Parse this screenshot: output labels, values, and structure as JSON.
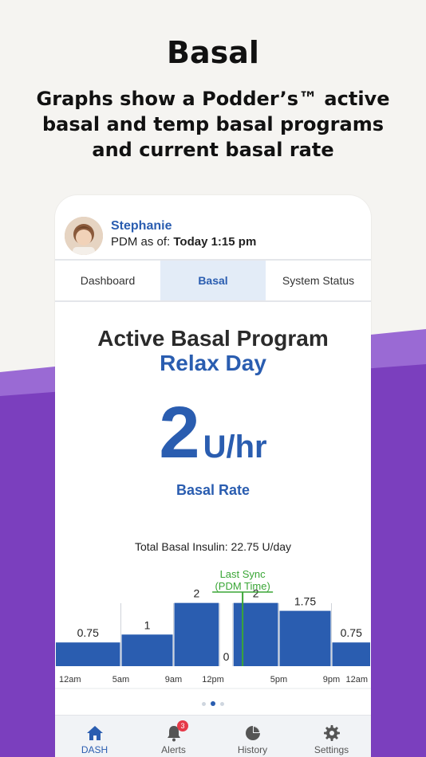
{
  "headline": "Basal",
  "subhead": "Graphs show a Podder’s™ active basal and temp basal programs and current basal rate",
  "profile": {
    "name": "Stephanie",
    "status_prefix": "PDM as of: ",
    "status_time": "Today 1:15 pm"
  },
  "tabs": [
    {
      "label": "Dashboard"
    },
    {
      "label": "Basal"
    },
    {
      "label": "System Status"
    }
  ],
  "program": {
    "heading": "Active Basal Program",
    "name": "Relax Day",
    "rate_value": "2",
    "rate_unit": "U/hr",
    "rate_label": "Basal Rate",
    "total_label": "Total Basal Insulin: 22.75 U/day"
  },
  "chart_data": {
    "type": "bar",
    "x_ticks": [
      "12am",
      "5am",
      "9am",
      "12pm",
      "5pm",
      "9pm",
      "12am"
    ],
    "segments": [
      {
        "start": 0,
        "end": 5,
        "value": 0.75,
        "label": "0.75"
      },
      {
        "start": 5,
        "end": 9,
        "value": 1,
        "label": "1"
      },
      {
        "start": 9,
        "end": 12.5,
        "value": 2,
        "label": "2"
      },
      {
        "start": 12.5,
        "end": 13.5,
        "value": 0,
        "label": "0"
      },
      {
        "start": 13.5,
        "end": 17,
        "value": 2,
        "label": "2"
      },
      {
        "start": 17,
        "end": 21,
        "value": 1.75,
        "label": "1.75"
      },
      {
        "start": 21,
        "end": 24,
        "value": 0.75,
        "label": "0.75"
      }
    ],
    "xlim": [
      0,
      24
    ],
    "ylim": [
      0,
      3.1
    ],
    "sync_marker": {
      "x": 14.25,
      "label_line1": "Last Sync",
      "label_line2": "(PDM Time)"
    },
    "colors": {
      "bar": "#2a5db0",
      "sync": "#3aa636",
      "divider": "#cfd3d9"
    }
  },
  "pager": {
    "count": 3,
    "active": 1
  },
  "nav": [
    {
      "label": "DASH",
      "icon": "home-icon"
    },
    {
      "label": "Alerts",
      "icon": "bell-icon",
      "badge": "3"
    },
    {
      "label": "History",
      "icon": "pie-chart-icon"
    },
    {
      "label": "Settings",
      "icon": "gear-icon"
    }
  ],
  "colors": {
    "brand_blue": "#2a5db0",
    "purple": "#7b3fbe",
    "purple_light": "#9a6ad4",
    "tab_active_bg": "#e3ecf7",
    "badge_red": "#e53948"
  }
}
